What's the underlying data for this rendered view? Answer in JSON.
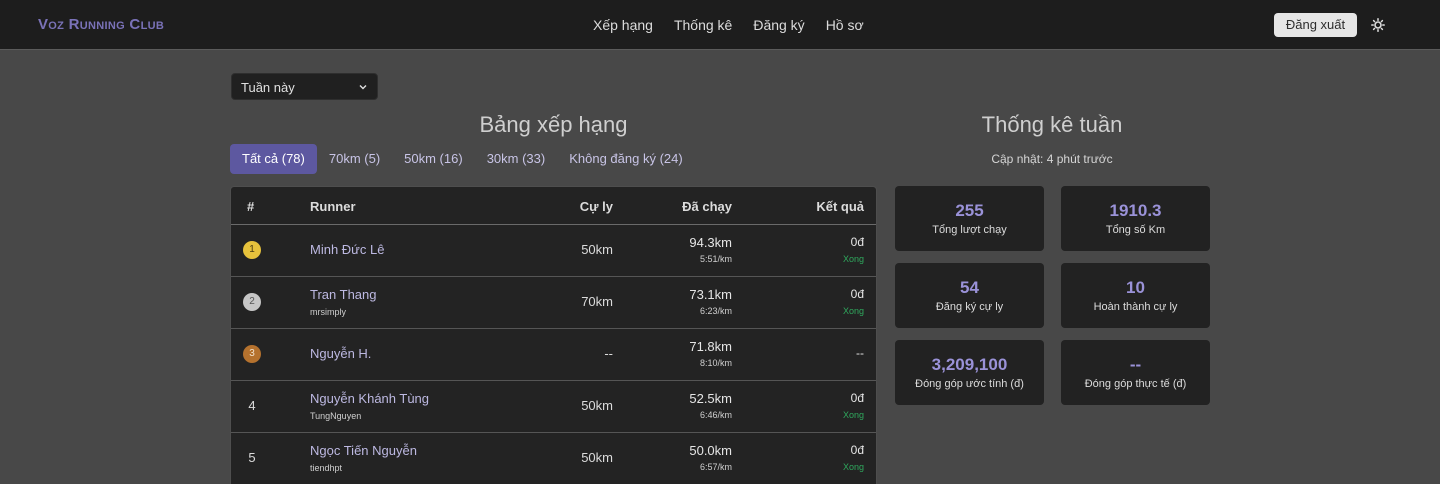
{
  "nav": {
    "brand": "Voz Running Club",
    "links": [
      "Xếp hạng",
      "Thống kê",
      "Đăng ký",
      "Hồ sơ"
    ],
    "logout": "Đăng xuất",
    "theme_icon": "sun-icon"
  },
  "filter": {
    "period": "Tuần này"
  },
  "leaderboard": {
    "title": "Bảng xếp hạng",
    "tabs": [
      "Tất cả (78)",
      "70km (5)",
      "50km (16)",
      "30km (33)",
      "Không đăng ký (24)"
    ],
    "active_tab": "Tất cả (78)",
    "columns": {
      "rank": "#",
      "runner": "Runner",
      "distance": "Cự ly",
      "run": "Đã chạy",
      "result": "Kết quả"
    },
    "rows": [
      {
        "rank": "1",
        "medal": "gold",
        "name": "Minh Đức Lê",
        "username": "",
        "target": "50km",
        "km": "94.3km",
        "pace": "5:51/km",
        "result": "0đ",
        "status": "Xong"
      },
      {
        "rank": "2",
        "medal": "silver",
        "name": "Tran Thang",
        "username": "mrsimply",
        "target": "70km",
        "km": "73.1km",
        "pace": "6:23/km",
        "result": "0đ",
        "status": "Xong"
      },
      {
        "rank": "3",
        "medal": "bronze",
        "name": "Nguyễn H.",
        "username": "",
        "target": "--",
        "km": "71.8km",
        "pace": "8:10/km",
        "result": "--",
        "status": ""
      },
      {
        "rank": "4",
        "medal": "",
        "name": "Nguyễn Khánh Tùng",
        "username": "TungNguyen",
        "target": "50km",
        "km": "52.5km",
        "pace": "6:46/km",
        "result": "0đ",
        "status": "Xong"
      },
      {
        "rank": "5",
        "medal": "",
        "name": "Ngọc Tiến Nguyễn",
        "username": "tiendhpt",
        "target": "50km",
        "km": "50.0km",
        "pace": "6:57/km",
        "result": "0đ",
        "status": "Xong"
      }
    ]
  },
  "stats": {
    "title": "Thống kê tuần",
    "updated": "Cập nhật: 4 phút trước",
    "cards": [
      {
        "value": "255",
        "label": "Tổng lượt chạy"
      },
      {
        "value": "1910.3",
        "label": "Tổng số Km"
      },
      {
        "value": "54",
        "label": "Đăng ký cự ly"
      },
      {
        "value": "10",
        "label": "Hoàn thành cự ly"
      },
      {
        "value": "3,209,100",
        "label": "Đóng góp ước tính (đ)"
      },
      {
        "value": "--",
        "label": "Đóng góp thực tế (đ)"
      }
    ]
  },
  "colors": {
    "accent": "#5d58a0",
    "link": "#bdb9e2",
    "success": "#2fa85d",
    "stat_value": "#9a92d8"
  }
}
